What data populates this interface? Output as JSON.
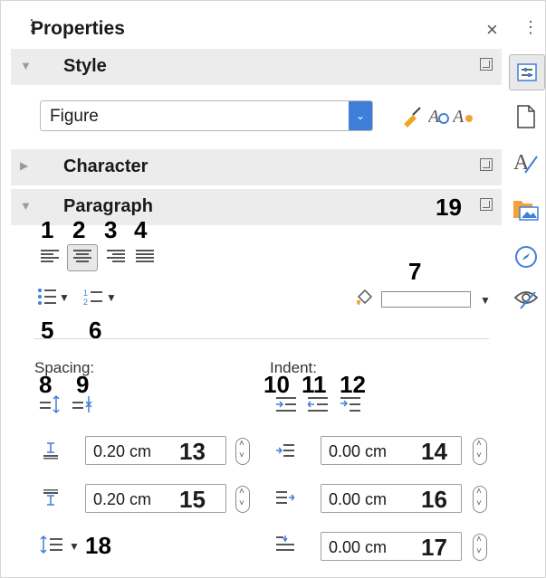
{
  "header": {
    "title": "Properties",
    "close": "×",
    "menu": "⋮",
    "grip": "⋮"
  },
  "style_section": {
    "label": "Style",
    "value": "Figure"
  },
  "character_section": {
    "label": "Character"
  },
  "paragraph_section": {
    "label": "Paragraph"
  },
  "spacing": {
    "label": "Spacing:"
  },
  "indent": {
    "label": "Indent:"
  },
  "fields": {
    "above": "0.20 cm",
    "below": "0.20 cm",
    "before": "0.00 cm",
    "after": "0.00 cm",
    "first": "0.00 cm"
  },
  "callouts": [
    "1",
    "2",
    "3",
    "4",
    "5",
    "6",
    "7",
    "8",
    "9",
    "10",
    "11",
    "12",
    "13",
    "14",
    "15",
    "16",
    "17",
    "18",
    "19"
  ]
}
